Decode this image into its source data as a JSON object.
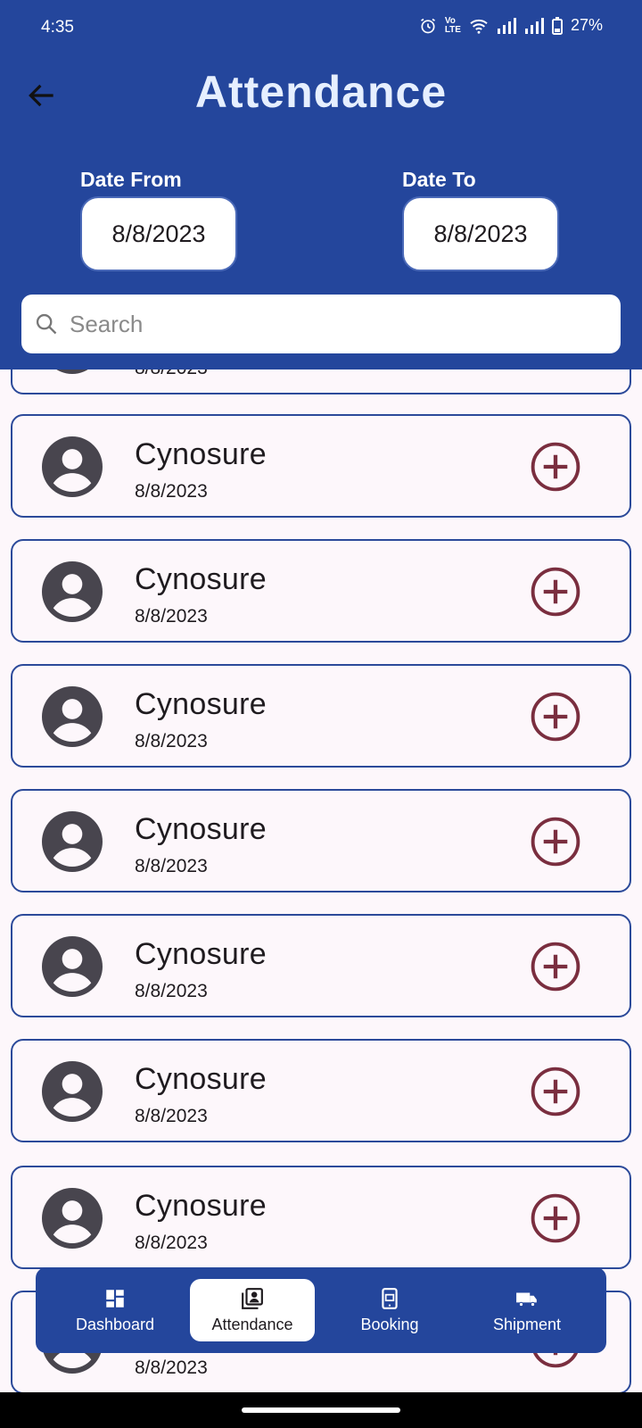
{
  "status_bar": {
    "time": "4:35",
    "battery": "27%",
    "icons": [
      "alarm-icon",
      "volte-icon",
      "wifi-icon",
      "signal-icon",
      "signal-icon",
      "battery-icon"
    ]
  },
  "header": {
    "title": "Attendance",
    "date_from_label": "Date From",
    "date_from_value": "8/8/2023",
    "date_to_label": "Date To",
    "date_to_value": "8/8/2023",
    "search_placeholder": "Search"
  },
  "records": [
    {
      "name": "",
      "date": "8/8/2023"
    },
    {
      "name": "Cynosure",
      "date": "8/8/2023"
    },
    {
      "name": "Cynosure",
      "date": "8/8/2023"
    },
    {
      "name": "Cynosure",
      "date": "8/8/2023"
    },
    {
      "name": "Cynosure",
      "date": "8/8/2023"
    },
    {
      "name": "Cynosure",
      "date": "8/8/2023"
    },
    {
      "name": "Cynosure",
      "date": "8/8/2023"
    },
    {
      "name": "Cynosure",
      "date": "8/8/2023"
    },
    {
      "name": "",
      "date": "8/8/2023"
    }
  ],
  "nav": [
    {
      "label": "Dashboard",
      "icon": "dashboard-icon",
      "active": false
    },
    {
      "label": "Attendance",
      "icon": "attendance-icon",
      "active": true
    },
    {
      "label": "Booking",
      "icon": "booking-icon",
      "active": false
    },
    {
      "label": "Shipment",
      "icon": "shipment-icon",
      "active": false
    }
  ],
  "colors": {
    "primary": "#24469c",
    "add_icon": "#7a2e3f",
    "avatar": "#48454e",
    "card_border": "#2c4a9a"
  }
}
